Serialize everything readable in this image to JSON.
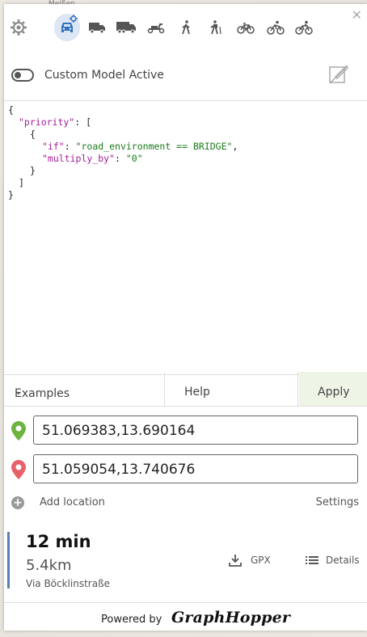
{
  "map": {
    "label": "Meißen"
  },
  "panel": {
    "close_icon": "close-icon"
  },
  "toolbar": {
    "items": [
      {
        "name": "settings-gear-icon"
      },
      {
        "name": "car-custom-icon",
        "active": true
      },
      {
        "name": "small-truck-icon"
      },
      {
        "name": "truck-icon"
      },
      {
        "name": "scooter-icon"
      },
      {
        "name": "foot-icon"
      },
      {
        "name": "hike-icon"
      },
      {
        "name": "bike-icon"
      },
      {
        "name": "racingbike-icon"
      },
      {
        "name": "mtb-icon"
      }
    ],
    "active_color": "#2e6fbf"
  },
  "custom_model": {
    "label": "Custom Model Active"
  },
  "editor": {
    "l1": "{",
    "l2_key": "\"priority\"",
    "l2_rest": ": [",
    "l3": "{",
    "l4_key": "\"if\"",
    "l4_sep": ": ",
    "l4_val": "\"road_environment == BRIDGE\"",
    "l4_end": ",",
    "l5_key": "\"multiply_by\"",
    "l5_sep": ": ",
    "l5_val": "\"0\"",
    "l6": "}",
    "l7": "]",
    "l8": "}"
  },
  "buttons": {
    "examples": "Examples",
    "help": "Help",
    "apply": "Apply"
  },
  "locations": {
    "from": "51.069383,13.690164",
    "to": "51.059054,13.740676",
    "from_color": "#6db33f",
    "to_color": "#e8616a"
  },
  "add_location": {
    "label": "Add location",
    "settings": "Settings"
  },
  "route": {
    "time": "12 min",
    "distance": "5.4km",
    "via": "Via Böcklinstraße",
    "gpx": "GPX",
    "details": "Details"
  },
  "footer": {
    "powered": "Powered by",
    "logo": "GraphHopper"
  }
}
